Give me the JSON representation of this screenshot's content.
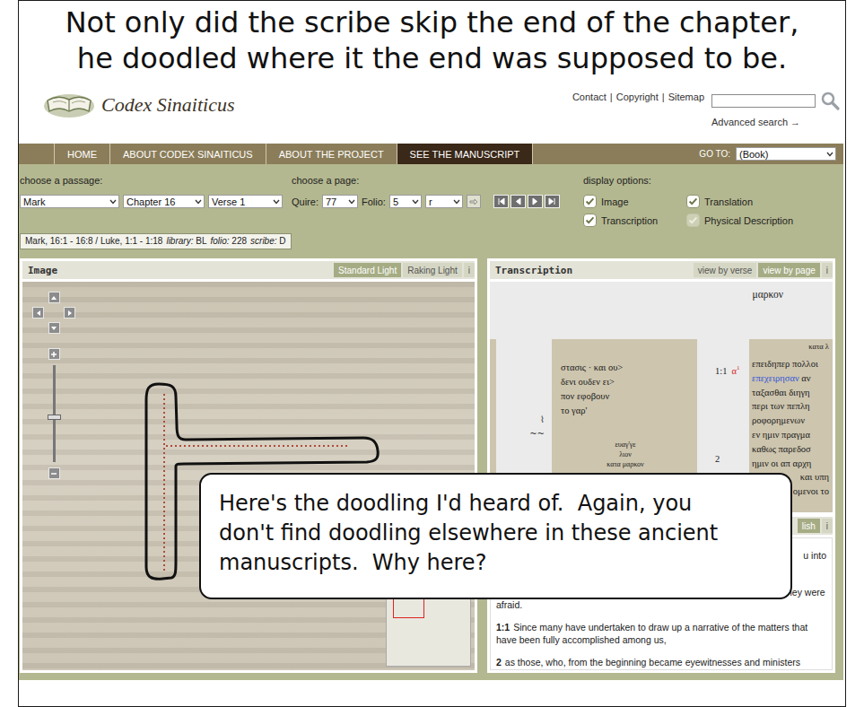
{
  "caption": {
    "lines": [
      "Not only did the scribe skip the end of the chapter,",
      "he doodled where it the end was supposed to be."
    ]
  },
  "site_header": {
    "logo_text": "Codex Sinaiticus",
    "links": [
      "Contact",
      "Copyright",
      "Sitemap"
    ],
    "link_separator": "|",
    "search": {
      "value": ""
    },
    "advanced_search": "Advanced search →"
  },
  "nav": {
    "items": [
      {
        "label": "HOME",
        "selected": false
      },
      {
        "label": "ABOUT CODEX SINAITICUS",
        "selected": false
      },
      {
        "label": "ABOUT THE PROJECT",
        "selected": false
      },
      {
        "label": "SEE THE MANUSCRIPT",
        "selected": true
      }
    ],
    "goto": {
      "label": "GO TO:",
      "value": "(Book)"
    }
  },
  "passage": {
    "label": "choose a passage:",
    "selects": [
      "Mark",
      "Chapter 16",
      "Verse 1"
    ]
  },
  "page": {
    "label": "choose a page:",
    "fields": [
      {
        "label": "Quire:",
        "value": "77"
      },
      {
        "label": "Folio:",
        "value": "5"
      },
      {
        "label": "",
        "value": "r"
      }
    ]
  },
  "display_options": {
    "label": "display options:",
    "options": [
      {
        "label": "Image",
        "checked": true,
        "disabled": false
      },
      {
        "label": "Translation",
        "checked": true,
        "disabled": false
      },
      {
        "label": "Transcription",
        "checked": true,
        "disabled": false
      },
      {
        "label": "Physical Description",
        "checked": true,
        "disabled": true
      }
    ]
  },
  "info": {
    "passage": "Mark, 16:1 - 16:8 / Luke, 1:1 - 1:18",
    "fields": [
      {
        "label": "library:",
        "value": "BL"
      },
      {
        "label": "folio:",
        "value": "228"
      },
      {
        "label": "scribe:",
        "value": "D"
      }
    ]
  },
  "image_panel": {
    "title": "Image",
    "buttons": [
      {
        "label": "Standard Light",
        "selected": true
      },
      {
        "label": "Raking Light",
        "selected": false
      }
    ],
    "info": "i",
    "zoom": {
      "level": 0.46
    }
  },
  "transcription_panel": {
    "title": "Transcription",
    "buttons": [
      {
        "label": "view by verse",
        "selected": false
      },
      {
        "label": "view by page",
        "selected": true
      }
    ],
    "info": "i",
    "page_title": "μαρκον",
    "left_column": {
      "lines": [
        "στασις · και ου>",
        "δενι ουδεν ει>",
        "πον εφοβουν",
        "το γαρ'"
      ],
      "marks": [
        "⌇",
        "~~"
      ],
      "colophon": [
        "ευαγ'γε",
        "λιον",
        "κατα μαρκον"
      ]
    },
    "verses": [
      {
        "number": "1:1",
        "letter": "α",
        "note": "1"
      },
      {
        "number": "2",
        "letter": "",
        "note": ""
      }
    ],
    "right_column": {
      "heading": "κατα λ",
      "lines": [
        {
          "segments": [
            {
              "text": "επειδηπερ πολλοι",
              "highlight": false
            }
          ],
          "partial": false
        },
        {
          "segments": [
            {
              "text": "επεχειρησαν",
              "highlight": true
            },
            {
              "text": " αν",
              "highlight": false
            }
          ],
          "partial": false
        },
        {
          "segments": [
            {
              "text": "ταξασθαι διηγη",
              "highlight": false
            }
          ],
          "partial": false
        },
        {
          "segments": [
            {
              "text": "περι των πεπλη",
              "highlight": false
            }
          ],
          "partial": false
        },
        {
          "segments": [
            {
              "text": "ροφορημενων",
              "highlight": false
            }
          ],
          "partial": false
        },
        {
          "segments": [
            {
              "text": "εν ημιν πραγμα",
              "highlight": false
            }
          ],
          "partial": false
        },
        {
          "segments": [
            {
              "text": "καθως παρεδοσ",
              "highlight": false
            }
          ],
          "partial": false
        },
        {
          "segments": [
            {
              "text": "ημιν οι απ αρχη",
              "highlight": false
            }
          ],
          "partial": false
        },
        {
          "segments": [
            {
              "text": "και υπη",
              "highlight": false
            }
          ],
          "partial": true
        },
        {
          "segments": [
            {
              "text": "ομενοι το",
              "highlight": false
            }
          ],
          "partial": true
        }
      ]
    }
  },
  "translation_panel": {
    "button": "lish",
    "info": "i",
    "partial_line": "u into",
    "paragraphs": [
      {
        "verse": "",
        "text": "astonishment had seized them, and they said nothing to any one, for they were afraid."
      },
      {
        "verse": "1:1",
        "text": "Since many have undertaken to draw up a narrative of the matters that have been fully accomplished among us,"
      },
      {
        "verse": "2",
        "text": "as those, who, from the beginning became eyewitnesses and ministers"
      }
    ]
  },
  "callout": {
    "lines": [
      "Here's the doodling I'd heard of.  Again, you",
      "don't find doodling elsewhere in these ancient",
      "manuscripts.  Why here?"
    ]
  }
}
